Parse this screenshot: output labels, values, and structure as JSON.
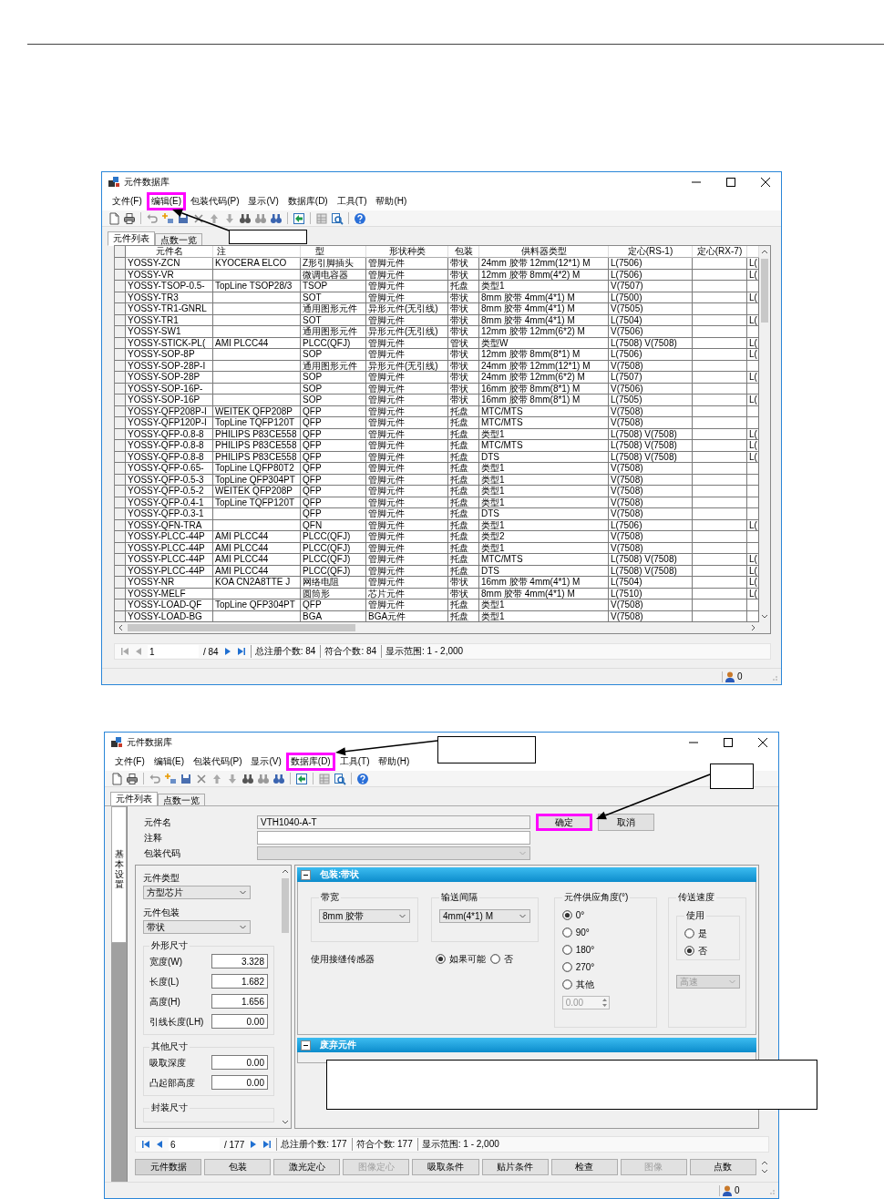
{
  "list_window": {
    "title": "元件数据库",
    "menu": [
      {
        "label": "文件(F)",
        "highlighted": false
      },
      {
        "label": "编辑(E)",
        "highlighted": true
      },
      {
        "label": "包装代码(P)",
        "highlighted": false
      },
      {
        "label": "显示(V)",
        "highlighted": false
      },
      {
        "label": "数据库(D)",
        "highlighted": false
      },
      {
        "label": "工具(T)",
        "highlighted": false
      },
      {
        "label": "帮助(H)",
        "highlighted": false
      }
    ],
    "tabs": [
      {
        "label": "元件列表",
        "selected": true
      },
      {
        "label": "点数一览",
        "selected": false
      }
    ],
    "table": {
      "columns": [
        "元件名",
        "注",
        "型",
        "形状种类",
        "包装",
        "供料器类型",
        "定心(RS-1)",
        "定心(RX-7)"
      ],
      "rows": [
        {
          "name": "YOSSY-ZCN",
          "note": "KYOCERA ELCO",
          "shape": "Z形引脚插头",
          "kind": "管脚元件",
          "pack": "带状",
          "feeder": "24mm 胶带 12mm(12*1) M",
          "rs1": "L(7506)",
          "column_9": "L("
        },
        {
          "name": "YOSSY-VR",
          "shape": "微调电容器",
          "kind": "管脚元件",
          "pack": "带状",
          "feeder": "12mm 胶带 8mm(4*2) M",
          "rs1": "L(7506)",
          "column_9": "L("
        },
        {
          "name": "YOSSY-TSOP-0.5-",
          "note": "TopLine TSOP28/3",
          "shape": "TSOP",
          "kind": "管脚元件",
          "pack": "托盘",
          "feeder": "类型1",
          "rs1": "V(7507)"
        },
        {
          "name": "YOSSY-TR3",
          "shape": "SOT",
          "kind": "管脚元件",
          "pack": "带状",
          "feeder": "8mm 胶带 4mm(4*1) M",
          "rs1": "L(7500)",
          "column_9": "L("
        },
        {
          "name": "YOSSY-TR1-GNRL",
          "shape": "通用图形元件",
          "kind": "异形元件(无引线)",
          "pack": "带状",
          "feeder": "8mm 胶带 4mm(4*1) M",
          "rs1": "V(7505)"
        },
        {
          "name": "YOSSY-TR1",
          "shape": "SOT",
          "kind": "管脚元件",
          "pack": "带状",
          "feeder": "8mm 胶带 4mm(4*1) M",
          "rs1": "L(7504)",
          "column_9": "L("
        },
        {
          "name": "YOSSY-SW1",
          "shape": "通用图形元件",
          "kind": "异形元件(无引线)",
          "pack": "带状",
          "feeder": "12mm 胶带 12mm(6*2) M",
          "rs1": "V(7506)"
        },
        {
          "name": "YOSSY-STICK-PL(",
          "note": "AMI PLCC44",
          "shape": "PLCC(QFJ)",
          "kind": "管脚元件",
          "pack": "管状",
          "feeder": "类型W",
          "rs1": "L(7508) V(7508)",
          "column_9": "L("
        },
        {
          "name": "YOSSY-SOP-8P",
          "shape": "SOP",
          "kind": "管脚元件",
          "pack": "带状",
          "feeder": "12mm 胶带 8mm(8*1) M",
          "rs1": "L(7506)",
          "column_9": "L("
        },
        {
          "name": "YOSSY-SOP-28P-I",
          "shape": "通用图形元件",
          "kind": "异形元件(无引线)",
          "pack": "带状",
          "feeder": "24mm 胶带 12mm(12*1) M",
          "rs1": "V(7508)"
        },
        {
          "name": "YOSSY-SOP-28P",
          "shape": "SOP",
          "kind": "管脚元件",
          "pack": "带状",
          "feeder": "24mm 胶带 12mm(6*2) M",
          "rs1": "L(7507)",
          "column_9": "L("
        },
        {
          "name": "YOSSY-SOP-16P-",
          "shape": "SOP",
          "kind": "管脚元件",
          "pack": "带状",
          "feeder": "16mm 胶带 8mm(8*1) M",
          "rs1": "V(7506)"
        },
        {
          "name": "YOSSY-SOP-16P",
          "shape": "SOP",
          "kind": "管脚元件",
          "pack": "带状",
          "feeder": "16mm 胶带 8mm(8*1) M",
          "rs1": "L(7505)",
          "column_9": "L("
        },
        {
          "name": "YOSSY-QFP208P-I",
          "note": "WEITEK QFP208P",
          "shape": "QFP",
          "kind": "管脚元件",
          "pack": "托盘",
          "feeder": "MTC/MTS",
          "rs1": "V(7508)"
        },
        {
          "name": "YOSSY-QFP120P-I",
          "note": "TopLine TQFP120T",
          "shape": "QFP",
          "kind": "管脚元件",
          "pack": "托盘",
          "feeder": "MTC/MTS",
          "rs1": "V(7508)"
        },
        {
          "name": "YOSSY-QFP-0.8-8",
          "note": "PHILIPS P83CE558",
          "shape": "QFP",
          "kind": "管脚元件",
          "pack": "托盘",
          "feeder": "类型1",
          "rs1": "L(7508) V(7508)",
          "column_9": "L("
        },
        {
          "name": "YOSSY-QFP-0.8-8",
          "note": "PHILIPS P83CE558",
          "shape": "QFP",
          "kind": "管脚元件",
          "pack": "托盘",
          "feeder": "MTC/MTS",
          "rs1": "L(7508) V(7508)",
          "column_9": "L("
        },
        {
          "name": "YOSSY-QFP-0.8-8",
          "note": "PHILIPS P83CE558",
          "shape": "QFP",
          "kind": "管脚元件",
          "pack": "托盘",
          "feeder": "DTS",
          "rs1": "L(7508) V(7508)",
          "column_9": "L("
        },
        {
          "name": "YOSSY-QFP-0.65-",
          "note": "TopLine LQFP80T2",
          "shape": "QFP",
          "kind": "管脚元件",
          "pack": "托盘",
          "feeder": "类型1",
          "rs1": "V(7508)"
        },
        {
          "name": "YOSSY-QFP-0.5-3",
          "note": "TopLine QFP304PT",
          "shape": "QFP",
          "kind": "管脚元件",
          "pack": "托盘",
          "feeder": "类型1",
          "rs1": "V(7508)"
        },
        {
          "name": "YOSSY-QFP-0.5-2",
          "note": "WEITEK QFP208P",
          "shape": "QFP",
          "kind": "管脚元件",
          "pack": "托盘",
          "feeder": "类型1",
          "rs1": "V(7508)"
        },
        {
          "name": "YOSSY-QFP-0.4-1",
          "note": "TopLine TQFP120T",
          "shape": "QFP",
          "kind": "管脚元件",
          "pack": "托盘",
          "feeder": "类型1",
          "rs1": "V(7508)"
        },
        {
          "name": "YOSSY-QFP-0.3-1",
          "shape": "QFP",
          "kind": "管脚元件",
          "pack": "托盘",
          "feeder": "DTS",
          "rs1": "V(7508)"
        },
        {
          "name": "YOSSY-QFN-TRA",
          "shape": "QFN",
          "kind": "管脚元件",
          "pack": "托盘",
          "feeder": "类型1",
          "rs1": "L(7506)",
          "column_9": "L("
        },
        {
          "name": "YOSSY-PLCC-44P",
          "note": "AMI PLCC44",
          "shape": "PLCC(QFJ)",
          "kind": "管脚元件",
          "pack": "托盘",
          "feeder": "类型2",
          "rs1": "V(7508)"
        },
        {
          "name": "YOSSY-PLCC-44P",
          "note": "AMI PLCC44",
          "shape": "PLCC(QFJ)",
          "kind": "管脚元件",
          "pack": "托盘",
          "feeder": "类型1",
          "rs1": "V(7508)"
        },
        {
          "name": "YOSSY-PLCC-44P",
          "note": "AMI PLCC44",
          "shape": "PLCC(QFJ)",
          "kind": "管脚元件",
          "pack": "托盘",
          "feeder": "MTC/MTS",
          "rs1": "L(7508) V(7508)",
          "column_9": "L("
        },
        {
          "name": "YOSSY-PLCC-44P",
          "note": "AMI PLCC44",
          "shape": "PLCC(QFJ)",
          "kind": "管脚元件",
          "pack": "托盘",
          "feeder": "DTS",
          "rs1": "L(7508) V(7508)",
          "column_9": "L("
        },
        {
          "name": "YOSSY-NR",
          "note": "KOA CN2A8TTE J",
          "shape": "网络电阻",
          "kind": "管脚元件",
          "pack": "带状",
          "feeder": "16mm 胶带 4mm(4*1) M",
          "rs1": "L(7504)",
          "column_9": "L("
        },
        {
          "name": "YOSSY-MELF",
          "shape": "圆筒形",
          "kind": "芯片元件",
          "pack": "带状",
          "feeder": "8mm 胶带 4mm(4*1) M",
          "rs1": "L(7510)",
          "column_9": "L("
        },
        {
          "name": "YOSSY-LOAD-QF",
          "note": "TopLine QFP304PT",
          "shape": "QFP",
          "kind": "管脚元件",
          "pack": "托盘",
          "feeder": "类型1",
          "rs1": "V(7508)"
        },
        {
          "name": "YOSSY-LOAD-BG",
          "shape": "BGA",
          "kind": "BGA元件",
          "pack": "托盘",
          "feeder": "类型1",
          "rs1": "V(7508)"
        }
      ]
    },
    "pager": {
      "at_first": true,
      "page": "1",
      "count": "/ 84",
      "stats": [
        "总注册个数: 84",
        "符合个数: 84",
        "显示范围: 1 - 2,000"
      ]
    },
    "status": "0"
  },
  "edit_window": {
    "title": "元件数据库",
    "menu": [
      {
        "label": "文件(F)",
        "highlighted": false
      },
      {
        "label": "编辑(E)",
        "highlighted": false
      },
      {
        "label": "包装代码(P)",
        "highlighted": false
      },
      {
        "label": "显示(V)",
        "highlighted": false
      },
      {
        "label": "数据库(D)",
        "highlighted": true
      },
      {
        "label": "工具(T)",
        "highlighted": false
      },
      {
        "label": "帮助(H)",
        "highlighted": false
      }
    ],
    "tabs": [
      {
        "label": "元件列表",
        "selected": true
      },
      {
        "label": "点数一览",
        "selected": false
      }
    ],
    "side_tab": "基本设置",
    "fields": [
      {
        "kind": "text",
        "label": "元件名",
        "value": "VTH1040-A-T"
      },
      {
        "kind": "text",
        "label": "注释"
      },
      {
        "kind": "dropdown",
        "label": "包装代码",
        "disabled": true
      }
    ],
    "actions": [
      {
        "label": "确定",
        "highlighted": true
      },
      {
        "label": "取消",
        "highlighted": false
      }
    ],
    "part_type": {
      "label": "元件类型",
      "value": "方型芯片"
    },
    "part_package": {
      "label": "元件包装",
      "value": "带状"
    },
    "groups": [
      {
        "title": "外形尺寸",
        "fields": [
          {
            "label": "宽度(W)",
            "value": "3.328"
          },
          {
            "label": "长度(L)",
            "value": "1.682"
          },
          {
            "label": "高度(H)",
            "value": "1.656"
          },
          {
            "label": "引线长度(LH)",
            "value": "0.00"
          }
        ]
      },
      {
        "title": "其他尺寸",
        "fields": [
          {
            "label": "吸取深度",
            "value": "0.00"
          },
          {
            "label": "凸起部高度",
            "value": "0.00"
          }
        ]
      },
      {
        "title": "封装尺寸"
      }
    ],
    "sections": [
      {
        "title": "包装:带状",
        "expanded": true
      },
      {
        "title": "废弃元件",
        "expanded": true
      }
    ],
    "tape": {
      "width": {
        "label": "带宽",
        "value": "8mm 胶带"
      },
      "pitch": {
        "label": "输送间隔",
        "value": "4mm(4*1) M"
      },
      "angle": {
        "label": "元件供应角度(°)",
        "options": [
          {
            "label": "0°",
            "selected": true
          },
          {
            "label": "90°",
            "selected": false
          },
          {
            "label": "180°",
            "selected": false
          },
          {
            "label": "270°",
            "selected": false
          },
          {
            "label": "其他",
            "selected": false
          }
        ],
        "custom": {
          "value": "0.00",
          "disabled": true
        }
      },
      "speed": {
        "label": "传送速度",
        "use_label": "使用",
        "options": [
          {
            "label": "是",
            "selected": false
          },
          {
            "label": "否",
            "selected": true
          }
        ],
        "value": "高速",
        "disabled": true
      },
      "sensor": {
        "label": "使用接缝传感器",
        "options": [
          {
            "label": "如果可能",
            "selected": true
          },
          {
            "label": "否",
            "selected": false
          }
        ]
      }
    },
    "pager": {
      "at_first": false,
      "page": "6",
      "count": "/ 177",
      "stats": [
        "总注册个数: 177",
        "符合个数: 177",
        "显示范围: 1 - 2,000"
      ]
    },
    "buttons": [
      {
        "label": "元件数据",
        "selected": true,
        "disabled": false
      },
      {
        "label": "包装",
        "selected": false,
        "disabled": false
      },
      {
        "label": "激光定心",
        "selected": false,
        "disabled": false
      },
      {
        "label": "图像定心",
        "selected": false,
        "disabled": true
      },
      {
        "label": "吸取条件",
        "selected": false,
        "disabled": false
      },
      {
        "label": "贴片条件",
        "selected": false,
        "disabled": false
      },
      {
        "label": "检查",
        "selected": false,
        "disabled": false
      },
      {
        "label": "图像",
        "selected": false,
        "disabled": true
      },
      {
        "label": "点数",
        "selected": false,
        "disabled": false
      }
    ],
    "status": "0"
  }
}
